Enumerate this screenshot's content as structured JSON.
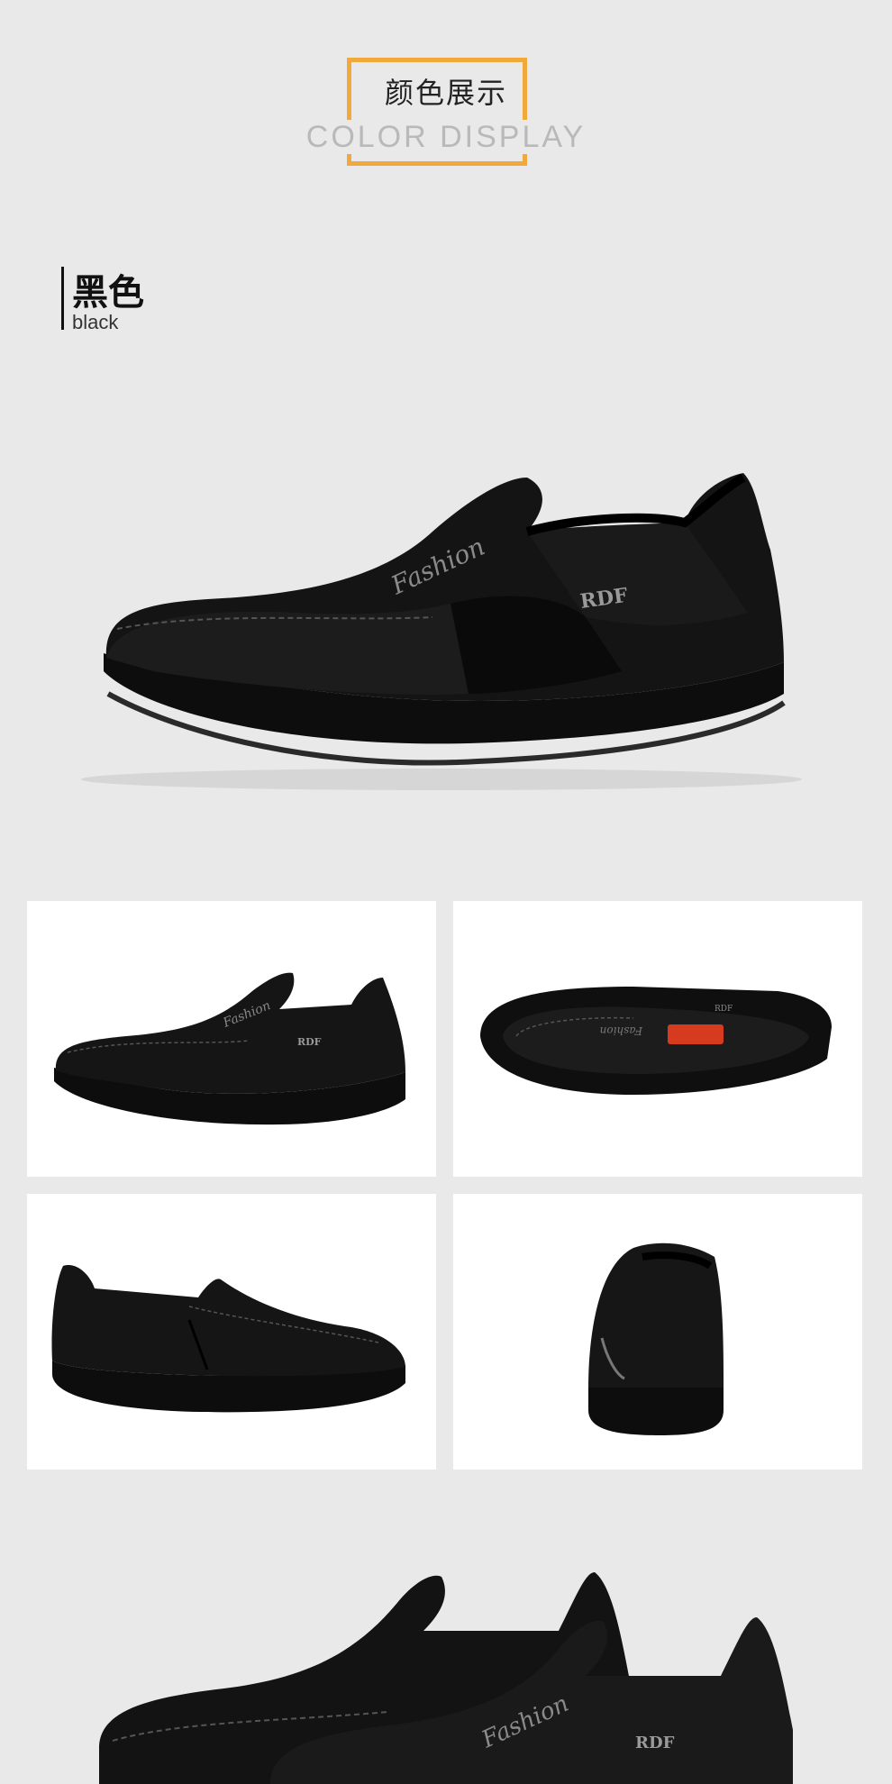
{
  "header": {
    "title_cn": "颜色展示",
    "title_en": "COLOR DISPLAY"
  },
  "color_section": {
    "name_cn": "黑色",
    "name_en": "black"
  },
  "product": {
    "fashion_text": "Fashion",
    "badge_text": "RDF"
  },
  "colors": {
    "accent": "#f2a93b",
    "background": "#e9e9e9",
    "shoe": "#111111",
    "insole_label": "#d63a1f"
  },
  "gallery": {
    "views": [
      "side-view",
      "top-view",
      "inner-side-view",
      "rear-view"
    ]
  }
}
